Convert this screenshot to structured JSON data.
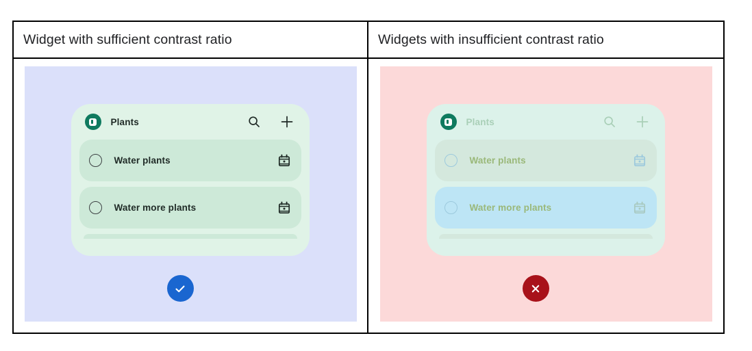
{
  "table": {
    "columns": [
      {
        "id": "sufficient",
        "header": "Widget with sufficient contrast ratio"
      },
      {
        "id": "insufficient",
        "header": "Widgets with insufficient contrast ratio"
      }
    ]
  },
  "panels": [
    {
      "id": "sufficient-panel",
      "background_color": "#dbe0fa",
      "widget": {
        "background_color": "#e0f3e7",
        "app_logo_icon": "app-logo-icon",
        "app_logo_color": "#0f7a5f",
        "title": "Plants",
        "title_color": "#1f2a26",
        "actions": [
          {
            "id": "search",
            "icon": "search-icon"
          },
          {
            "id": "add",
            "icon": "plus-icon"
          }
        ],
        "tasks": [
          {
            "id": "task-1",
            "label": "Water plants",
            "checkbox_icon": "checkbox-circle-icon",
            "trailing_icon": "calendar-icon",
            "row_color": "#cde9d8",
            "text_color": "#1f2a26"
          },
          {
            "id": "task-2",
            "label": "Water more plants",
            "checkbox_icon": "checkbox-circle-icon",
            "trailing_icon": "calendar-icon",
            "row_color": "#cde9d8",
            "text_color": "#1f2a26"
          }
        ]
      },
      "verdict": {
        "state": "pass",
        "icon": "check-icon",
        "color": "#1a66d0"
      }
    },
    {
      "id": "insufficient-panel",
      "background_color": "#fcd9d9",
      "widget": {
        "background_color": "#dcf2ea",
        "app_logo_icon": "app-logo-icon",
        "app_logo_color": "#0f7a5f",
        "title": "Plants",
        "title_color": "#a9cfb7",
        "actions": [
          {
            "id": "search",
            "icon": "search-icon"
          },
          {
            "id": "add",
            "icon": "plus-icon"
          }
        ],
        "tasks": [
          {
            "id": "task-1",
            "label": "Water plants",
            "checkbox_icon": "checkbox-circle-icon",
            "trailing_icon": "calendar-icon",
            "row_color": "#d4e8dd",
            "text_color": "#9ab879"
          },
          {
            "id": "task-2",
            "label": "Water more plants",
            "checkbox_icon": "checkbox-circle-icon",
            "trailing_icon": "calendar-icon",
            "row_color": "#bde5f5",
            "text_color": "#9ab879"
          }
        ]
      },
      "verdict": {
        "state": "fail",
        "icon": "close-icon",
        "color": "#a8121a"
      }
    }
  ]
}
